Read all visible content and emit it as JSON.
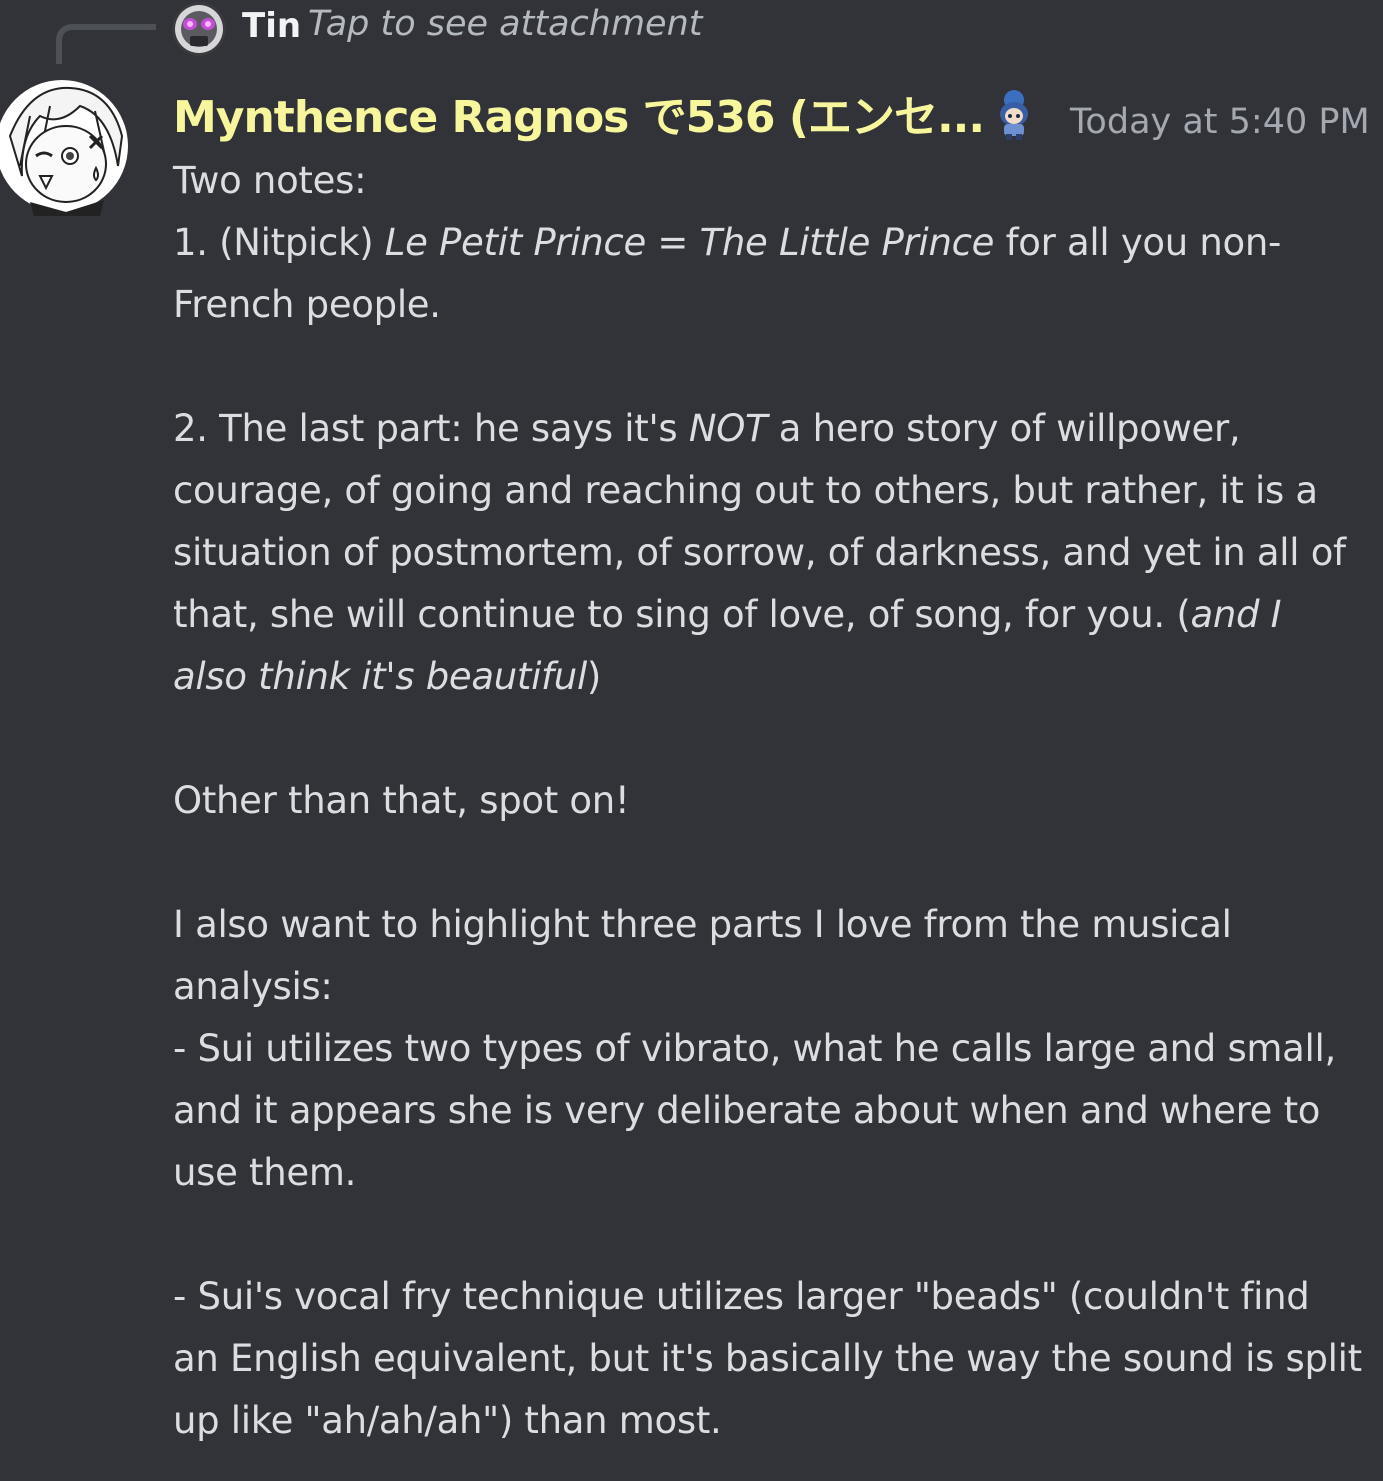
{
  "reply": {
    "author": "Tin",
    "preview": "Tap to see attachment"
  },
  "message": {
    "author": "Mynthence Ragnos で536 (エンセ...",
    "timestamp": "Today at 5:40 PM",
    "line_two_notes": "Two notes:",
    "note1_prefix": "1. (Nitpick) ",
    "note1_title_fr": "Le Petit Prince",
    "note1_eq": " = ",
    "note1_title_en": "The Little Prince",
    "note1_suffix": " for all you non-French people.",
    "note2_prefix": "2. The last part: he says it's ",
    "note2_emph": "NOT",
    "note2_suffix": " a hero story of willpower, courage, of going and reaching out to others, but rather, it is a situation of postmortem, of sorrow, of darkness, and yet in all of that, she will continue to sing of love, of song, for you. (",
    "note2_aside": "and I also think it's beautiful",
    "note2_close": ")",
    "other": "Other than that, spot on!",
    "highlight_intro": "I also want to highlight three parts I love from the musical analysis:",
    "bullet1": "- Sui utilizes two types of vibrato, what he calls large and small, and it appears she is very deliberate about when and where to use them.",
    "bullet2": "- Sui's vocal fry technique utilizes larger \"beads\" (couldn't find an English equivalent, but it's basically the way the sound is split up like \"ah/ah/ah\") than most."
  },
  "colors": {
    "background": "#313338",
    "author_name": "#f8f69c",
    "text": "#dbdee1",
    "muted": "#a4a8b0"
  },
  "icons": {
    "reply_avatar": "robot-avatar",
    "main_avatar": "anime-girl-avatar",
    "role_icon": "chibi-character-icon"
  }
}
